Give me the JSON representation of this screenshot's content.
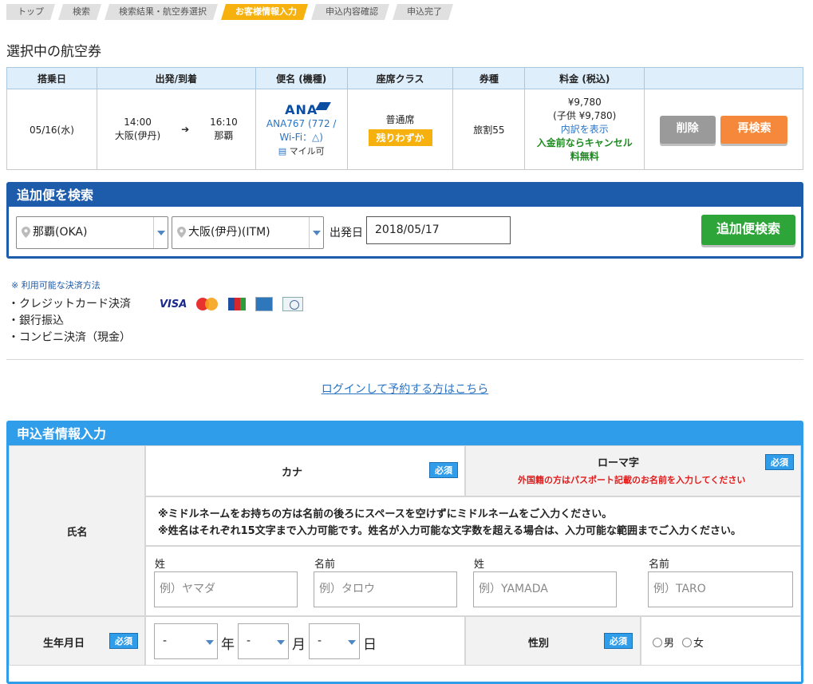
{
  "steps": [
    {
      "label": "トップ"
    },
    {
      "label": "検索"
    },
    {
      "label": "検索結果・航空券選択"
    },
    {
      "label": "お客様情報入力",
      "active": true
    },
    {
      "label": "申込内容確認"
    },
    {
      "label": "申込完了"
    }
  ],
  "selected_flights": {
    "title": "選択中の航空券",
    "headers": [
      "搭乗日",
      "出発/到着",
      "便名 (機種)",
      "座席クラス",
      "券種",
      "料金 (税込)",
      ""
    ],
    "row": {
      "date": "05/16(水)",
      "depart_time": "14:00",
      "depart_place": "大阪(伊丹)",
      "arrive_time": "16:10",
      "arrive_place": "那覇",
      "airline_logo": "ANA",
      "flight_line1": "ANA767 (772 /",
      "flight_line2": "Wi-Fi：△)",
      "mile": "マイル可",
      "seat_class": "普通席",
      "seat_badge": "残りわずか",
      "fare_type": "旅割55",
      "price": "¥9,780",
      "child_price": "(子供 ¥9,780)",
      "breakdown_link": "内訳を表示",
      "cancel_note_1": "入金前ならキャンセル",
      "cancel_note_2": "料無料",
      "delete_label": "削除",
      "research_label": "再検索"
    }
  },
  "add_search": {
    "title": "追加便を検索",
    "from": "那覇(OKA)",
    "to": "大阪(伊丹)(ITM)",
    "date_label": "出発日",
    "date_value": "2018/05/17",
    "button": "追加便検索"
  },
  "payment": {
    "note": "※ 利用可能な決済方法",
    "methods": [
      "・クレジットカード決済",
      "・銀行振込",
      "・コンビニ決済（現金）"
    ],
    "visa_label": "VISA"
  },
  "login_link": "ログインして予約する方はこちら",
  "applicant": {
    "title": "申込者情報入力",
    "name_label": "氏名",
    "kana_label": "カナ",
    "roman_label": "ローマ字",
    "required": "必須",
    "roman_note": "外国籍の方はパスポート記載のお名前を入力してください",
    "middle_note_1": "※ミドルネームをお持ちの方は名前の後ろにスペースを空けずにミドルネームをご入力ください。",
    "middle_note_2": "※姓名はそれぞれ15文字まで入力可能です。姓名が入力可能な文字数を超える場合は、入力可能な範囲までご入力ください。",
    "sei": "姓",
    "mei": "名前",
    "ph_kana_sei": "例）ヤマダ",
    "ph_kana_mei": "例）タロウ",
    "ph_roman_sei": "例）YAMADA",
    "ph_roman_mei": "例）TARO",
    "birth_label": "生年月日",
    "year_value": "-",
    "year_unit": "年",
    "month_value": "-",
    "month_unit": "月",
    "day_value": "-",
    "day_unit": "日",
    "gender_label": "性別",
    "male": "男",
    "female": "女"
  }
}
